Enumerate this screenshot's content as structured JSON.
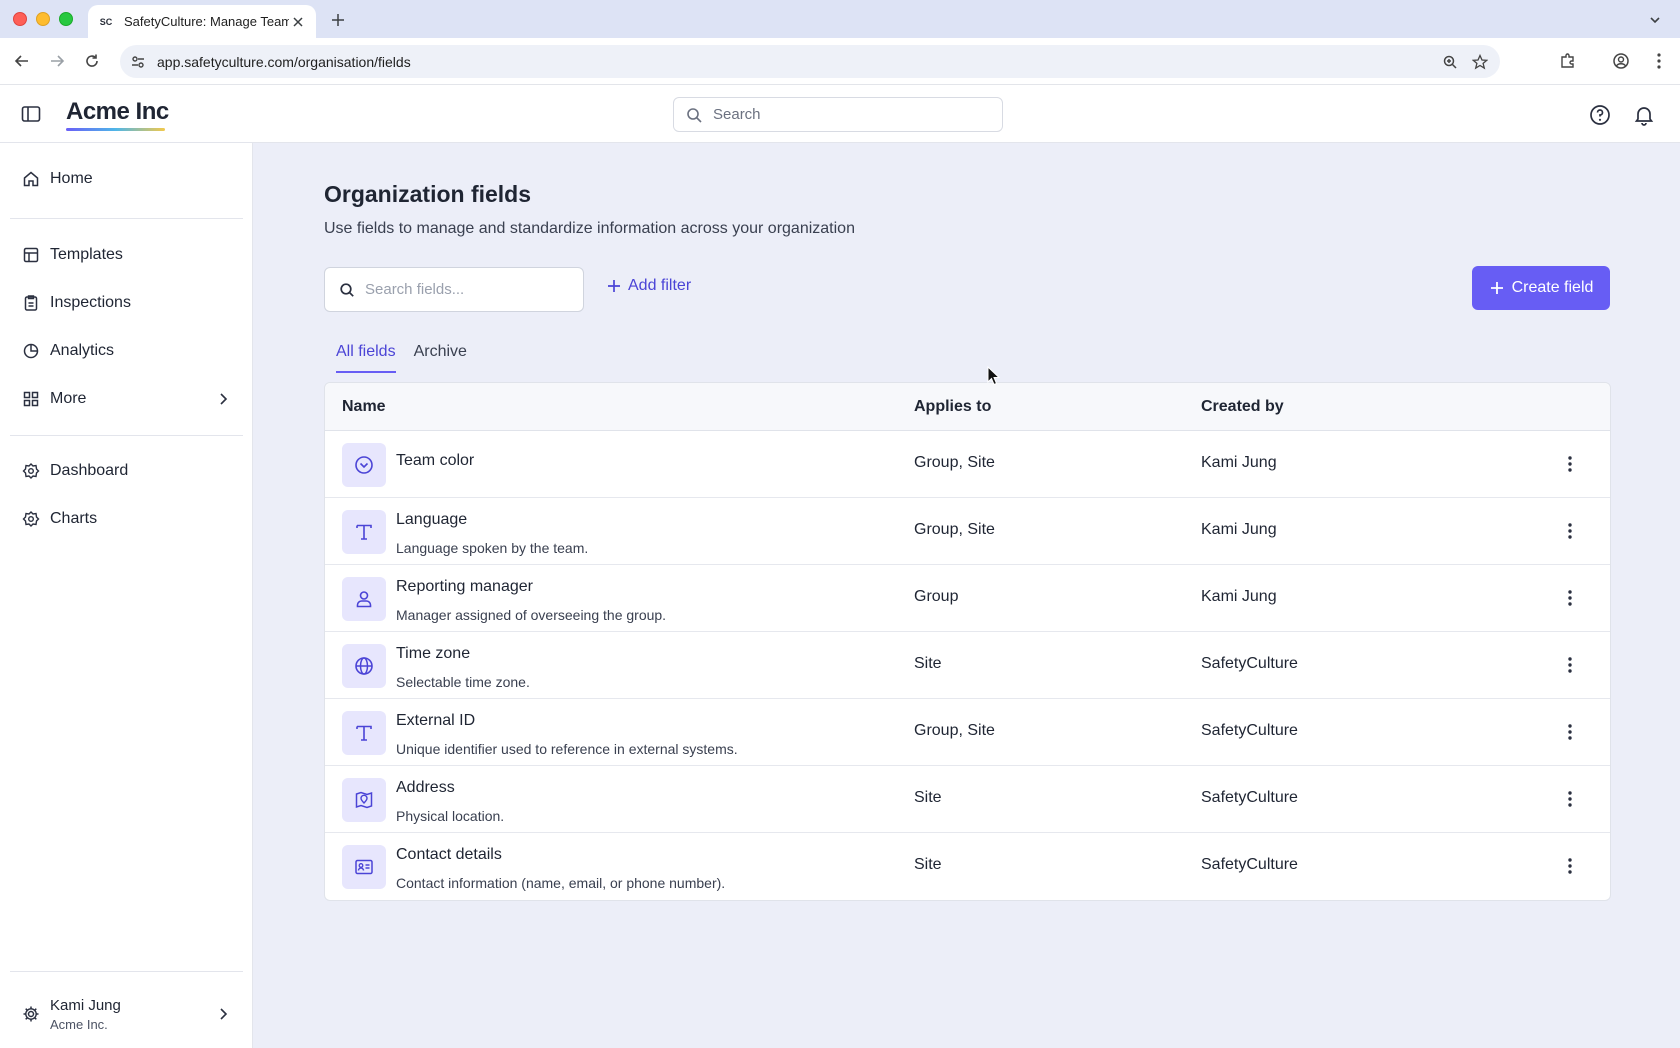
{
  "browser": {
    "tab_title": "SafetyCulture: Manage Teams",
    "favicon_text": "SC",
    "url": "app.safetyculture.com/organisation/fields"
  },
  "header": {
    "logo": "Acme Inc",
    "search_placeholder": "Search"
  },
  "sidebar": {
    "items": [
      {
        "label": "Home",
        "icon": "home-icon"
      },
      {
        "label": "Templates",
        "icon": "templates-icon"
      },
      {
        "label": "Inspections",
        "icon": "inspections-icon"
      },
      {
        "label": "Analytics",
        "icon": "analytics-icon"
      },
      {
        "label": "More",
        "icon": "grid-icon"
      },
      {
        "label": "Dashboard",
        "icon": "dashboard-icon"
      },
      {
        "label": "Charts",
        "icon": "charts-icon"
      }
    ],
    "user": {
      "name": "Kami Jung",
      "org": "Acme Inc."
    }
  },
  "main": {
    "title": "Organization fields",
    "subtitle": "Use fields to manage and standardize information across your organization",
    "search_placeholder": "Search fields...",
    "add_filter": "Add filter",
    "create_field": "Create field",
    "tabs": [
      {
        "label": "All fields",
        "active": true
      },
      {
        "label": "Archive",
        "active": false
      }
    ],
    "table": {
      "headers": {
        "name": "Name",
        "applies": "Applies to",
        "created": "Created by"
      },
      "rows": [
        {
          "title": "Team color",
          "desc": "",
          "applies": "Group, Site",
          "created": "Kami Jung",
          "icon": "dropdown-icon"
        },
        {
          "title": "Language",
          "desc": "Language spoken by the team.",
          "applies": "Group, Site",
          "created": "Kami Jung",
          "icon": "text-icon"
        },
        {
          "title": "Reporting manager",
          "desc": "Manager assigned of overseeing the group.",
          "applies": "Group",
          "created": "Kami Jung",
          "icon": "person-icon"
        },
        {
          "title": "Time zone",
          "desc": "Selectable time zone.",
          "applies": "Site",
          "created": "SafetyCulture",
          "icon": "globe-icon"
        },
        {
          "title": "External ID",
          "desc": "Unique identifier used to reference in external systems.",
          "applies": "Group, Site",
          "created": "SafetyCulture",
          "icon": "text-icon"
        },
        {
          "title": "Address",
          "desc": "Physical location.",
          "applies": "Site",
          "created": "SafetyCulture",
          "icon": "map-pin-icon"
        },
        {
          "title": "Contact details",
          "desc": "Contact information (name, email, or phone number).",
          "applies": "Site",
          "created": "SafetyCulture",
          "icon": "contact-card-icon"
        }
      ]
    }
  },
  "colors": {
    "accent": "#675df4",
    "accent_text": "#4b44d6",
    "icon_bg": "#e7e6fd",
    "page_bg": "#eceef8"
  }
}
